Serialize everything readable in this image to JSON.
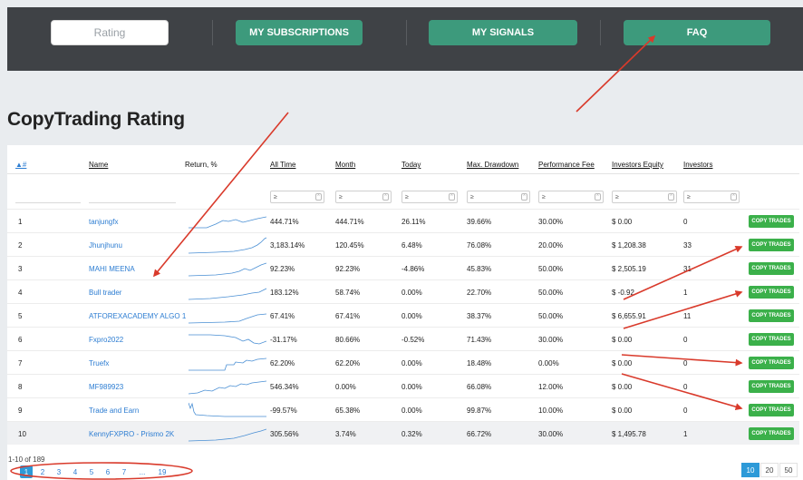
{
  "nav": {
    "rating": "Rating",
    "subscriptions": "MY SUBSCRIPTIONS",
    "signals": "MY SIGNALS",
    "faq": "FAQ"
  },
  "page": {
    "title": "CopyTrading Rating"
  },
  "table": {
    "columns": {
      "num": "▲#",
      "name": "Name",
      "return": "Return, %",
      "all_time": "All Time",
      "month": "Month",
      "today": "Today",
      "max_drawdown": "Max. Drawdown",
      "performance_fee": "Performance Fee",
      "investors_equity": "Investors Equity",
      "investors": "Investors"
    },
    "filter_symbol": "≥",
    "copy_label": "COPY TRADES",
    "rows": [
      {
        "num": "1",
        "name": "tanjungfx",
        "all_time": "444.71%",
        "month": "444.71%",
        "today": "26.11%",
        "drawdown": "39.66%",
        "fee": "30.00%",
        "equity": "$ 0.00",
        "investors": "0"
      },
      {
        "num": "2",
        "name": "Jhunjhunu",
        "all_time": "3,183.14%",
        "month": "120.45%",
        "today": "6.48%",
        "drawdown": "76.08%",
        "fee": "20.00%",
        "equity": "$ 1,208.38",
        "investors": "33"
      },
      {
        "num": "3",
        "name": "MAHI MEENA",
        "all_time": "92.23%",
        "month": "92.23%",
        "today": "-4.86%",
        "drawdown": "45.83%",
        "fee": "50.00%",
        "equity": "$ 2,505.19",
        "investors": "31"
      },
      {
        "num": "4",
        "name": "Bull trader",
        "all_time": "183.12%",
        "month": "58.74%",
        "today": "0.00%",
        "drawdown": "22.70%",
        "fee": "50.00%",
        "equity": "$ -0.92",
        "investors": "1"
      },
      {
        "num": "5",
        "name": "ATFOREXACADEMY ALGO 1",
        "all_time": "67.41%",
        "month": "67.41%",
        "today": "0.00%",
        "drawdown": "38.37%",
        "fee": "50.00%",
        "equity": "$ 6,655.91",
        "investors": "11"
      },
      {
        "num": "6",
        "name": "Fxpro2022",
        "all_time": "-31.17%",
        "month": "80.66%",
        "today": "-0.52%",
        "drawdown": "71.43%",
        "fee": "30.00%",
        "equity": "$ 0.00",
        "investors": "0"
      },
      {
        "num": "7",
        "name": "Truefx",
        "all_time": "62.20%",
        "month": "62.20%",
        "today": "0.00%",
        "drawdown": "18.48%",
        "fee": "0.00%",
        "equity": "$ 0.00",
        "investors": "0"
      },
      {
        "num": "8",
        "name": "MF989923",
        "all_time": "546.34%",
        "month": "0.00%",
        "today": "0.00%",
        "drawdown": "66.08%",
        "fee": "12.00%",
        "equity": "$ 0.00",
        "investors": "0"
      },
      {
        "num": "9",
        "name": "Trade and Earn",
        "all_time": "-99.57%",
        "month": "65.38%",
        "today": "0.00%",
        "drawdown": "99.87%",
        "fee": "10.00%",
        "equity": "$ 0.00",
        "investors": "0"
      },
      {
        "num": "10",
        "name": "KennyFXPRO - Prismo 2K",
        "all_time": "305.56%",
        "month": "3.74%",
        "today": "0.32%",
        "drawdown": "66.72%",
        "fee": "30.00%",
        "equity": "$ 1,495.78",
        "investors": "1"
      }
    ]
  },
  "pagination": {
    "info": "1-10 of 189",
    "pages": [
      "1",
      "2",
      "3",
      "4",
      "5",
      "6",
      "7",
      "...",
      "19"
    ],
    "active_page": "1",
    "page_sizes": [
      "10",
      "20",
      "50"
    ],
    "active_size": "10"
  },
  "colors": {
    "accent_green": "#3d9a7c",
    "copy_green": "#3bb04a",
    "link_blue": "#2d7dd2",
    "annotation_red": "#d93a2b"
  }
}
